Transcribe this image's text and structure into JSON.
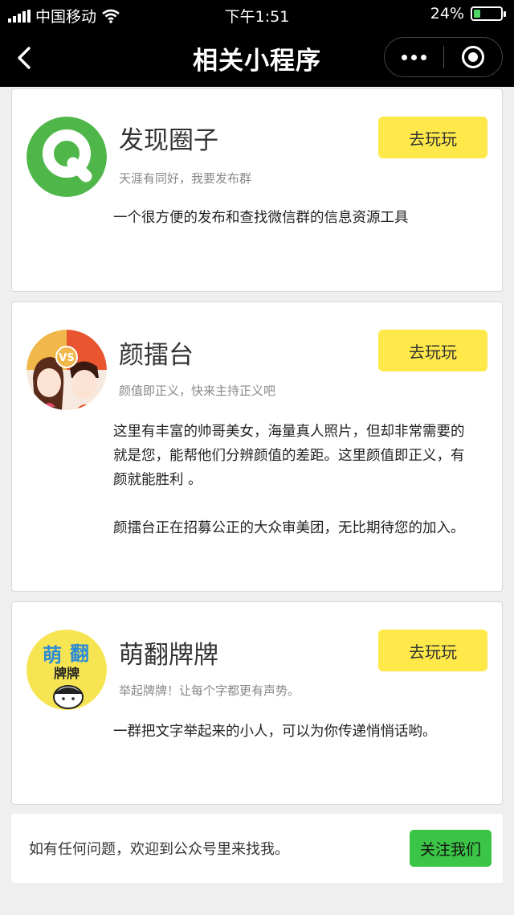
{
  "status_bar": {
    "carrier": "中国移动",
    "time": "下午1:51",
    "battery": "24%",
    "battery_level": 0.24
  },
  "nav": {
    "title": "相关小程序",
    "back_icon": "chevron-left-icon",
    "more_icon": "more-dots-icon",
    "close_icon": "target-close-icon"
  },
  "apps": [
    {
      "name": "发现圈子",
      "subtitle": "天涯有同好，我要发布群",
      "button": "去玩玩",
      "description": [
        "一个很方便的发布和查找微信群的信息资源工具"
      ]
    },
    {
      "name": "颜擂台",
      "subtitle": "颜值即正义，快来主持正义吧",
      "button": "去玩玩",
      "description": [
        "这里有丰富的帅哥美女，海量真人照片，但却非常需要的就是您，能帮他们分辨颜值的差距。这里颜值即正义，有颜就能胜利 。",
        "颜擂台正在招募公正的大众审美团，无比期待您的加入。"
      ]
    },
    {
      "name": "萌翻牌牌",
      "subtitle": "举起牌牌！让每个字都更有声势。",
      "button": "去玩玩",
      "description": [
        "一群把文字举起来的小人，可以为你传递悄悄话哟。"
      ]
    }
  ],
  "footer": {
    "text": "如有任何问题，欢迎到公众号里来找我。",
    "button": "关注我们"
  },
  "colors": {
    "play_button": "#ffe94a",
    "follow_button": "#3cc447",
    "battery_fill": "#4cd964"
  }
}
